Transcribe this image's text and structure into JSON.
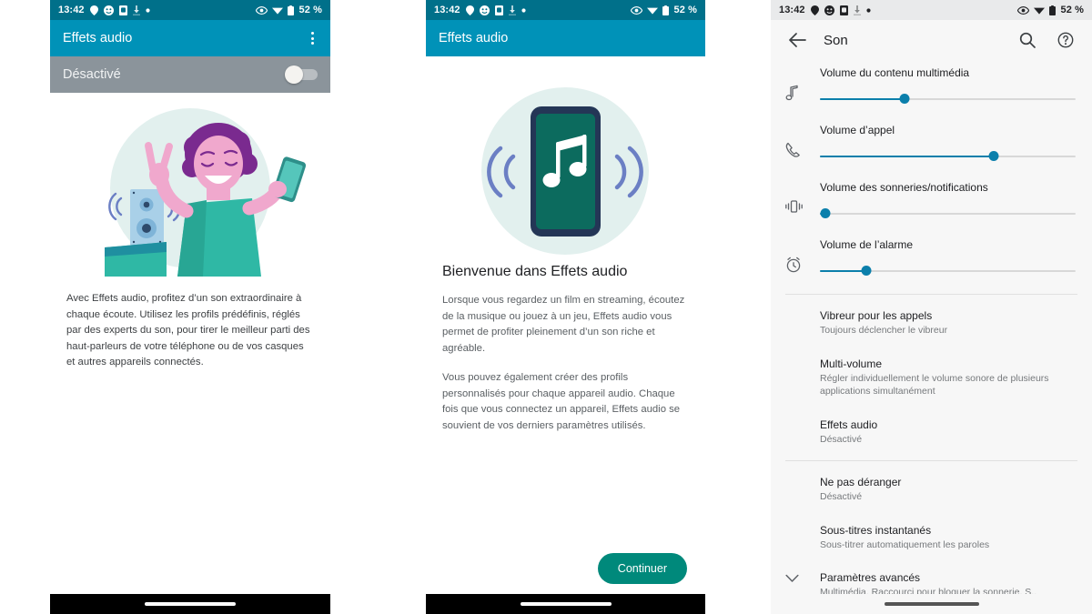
{
  "status_bar": {
    "time": "13:42",
    "battery_text": "52 %",
    "left_icons": [
      "location-pin-icon",
      "smiley-face-icon",
      "sim-card-icon",
      "download-icon",
      "dot-icon"
    ],
    "right_icons": [
      "eye-icon",
      "wifi-icon",
      "battery-icon"
    ]
  },
  "colors": {
    "appbar": "#0092b8",
    "statusbar_dark": "#00708a",
    "toggle_row": "#8b949b",
    "accent_teal": "#00897b",
    "slider_accent": "#0b7fab",
    "illustration_bg": "#e2f0ee",
    "illustration_pink": "#f0a8cd",
    "illustration_purple": "#7a2a8f",
    "illustration_teal": "#2fb8a5",
    "illustration_blue": "#6b7fc4",
    "phone_screen": "#0c6b5e",
    "phone_frame": "#243656",
    "statusbar_light": "#e9eaeb"
  },
  "panel_1": {
    "appbar_title": "Effets audio",
    "overflow_menu": "more-options",
    "toggle_label": "Désactivé",
    "toggle_state": "off",
    "illustration": "woman-with-phone-and-speaker",
    "body_text": "Avec Effets audio, profitez d’un son extraordinaire à chaque écoute. Utilisez les profils prédéfinis, réglés par des experts du son, pour tirer le meilleur parti des haut-parleurs de votre téléphone ou de vos casques et autres appareils connectés."
  },
  "panel_2": {
    "appbar_title": "Effets audio",
    "illustration": "phone-playing-music-with-sound-waves",
    "title": "Bienvenue dans Effets audio",
    "paragraphs": [
      "Lorsque vous regardez un film en streaming, écoutez de la musique ou jouez à un jeu, Effets audio vous permet de profiter pleinement d’un son riche et agréable.",
      "Vous pouvez également créer des profils personnalisés pour chaque appareil audio. Chaque fois que vous connectez un appareil, Effets audio se souvient de vos derniers paramètres utilisés."
    ],
    "cta_label": "Continuer"
  },
  "panel_3": {
    "topbar": {
      "back": "back-arrow",
      "title": "Son",
      "search": "search",
      "help": "help"
    },
    "volume_sliders": [
      {
        "icon": "music-note-icon",
        "label": "Volume du contenu multimédia",
        "value": 33
      },
      {
        "icon": "phone-call-icon",
        "label": "Volume d’appel",
        "value": 68
      },
      {
        "icon": "vibrate-icon",
        "label": "Volume des sonneries/notifications",
        "value": 2
      },
      {
        "icon": "alarm-clock-icon",
        "label": "Volume de l’alarme",
        "value": 18
      }
    ],
    "group_a": [
      {
        "title": "Vibreur pour les appels",
        "subtitle": "Toujours déclencher le vibreur"
      },
      {
        "title": "Multi-volume",
        "subtitle": "Régler individuellement le volume sonore de plusieurs applications simultanément"
      },
      {
        "title": "Effets audio",
        "subtitle": "Désactivé"
      }
    ],
    "group_b": [
      {
        "title": "Ne pas déranger",
        "subtitle": "Désactivé"
      },
      {
        "title": "Sous-titres instantanés",
        "subtitle": "Sous-titrer automatiquement les paroles"
      },
      {
        "title": "Paramètres avancés",
        "subtitle": "Multimédia, Raccourci pour bloquer la sonnerie, S..",
        "icon": "chevron-down-icon"
      }
    ]
  }
}
